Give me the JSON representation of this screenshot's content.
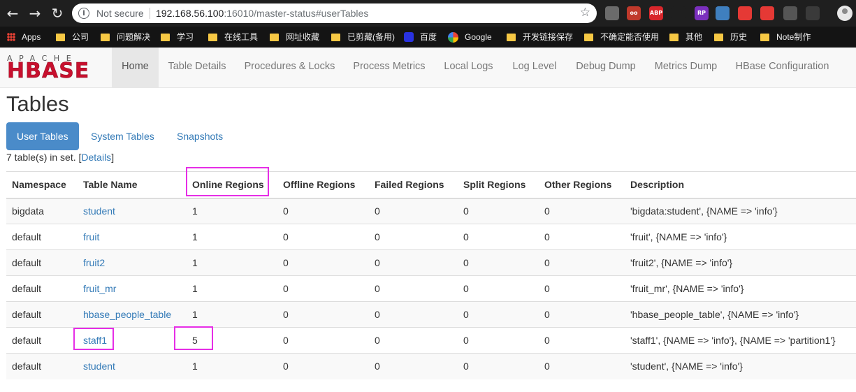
{
  "browser": {
    "security_label": "Not secure",
    "url_host": "192.168.56.100",
    "url_path": ":16010/master-status#userTables",
    "extensions": [
      {
        "name": "evernote-icon",
        "text": "",
        "color": "#6b6b6b"
      },
      {
        "name": "owl-icon",
        "text": "oo",
        "color": "#c0392b"
      },
      {
        "name": "adblock-icon",
        "text": "ABP",
        "color": "#d8262b"
      },
      {
        "name": "cursor-icon",
        "text": "",
        "color": "#1f1f1f"
      },
      {
        "name": "rp-icon",
        "text": "RP",
        "color": "#7b2fbe"
      },
      {
        "name": "circle-icon",
        "text": "",
        "color": "#3f7fbf"
      },
      {
        "name": "search-ext-icon",
        "text": "",
        "color": "#e53935"
      },
      {
        "name": "red-ext-icon",
        "text": "",
        "color": "#e53935"
      },
      {
        "name": "cloud-icon",
        "text": "",
        "color": "#555555"
      },
      {
        "name": "face-icon",
        "text": "",
        "color": "#3a3a3a"
      }
    ]
  },
  "bookmarks": [
    {
      "label": "Apps",
      "icon": "apps-icon"
    },
    {
      "label": "公司",
      "icon": "folder-icon"
    },
    {
      "label": "问题解决",
      "icon": "folder-icon"
    },
    {
      "label": "学习",
      "icon": "folder-icon"
    },
    {
      "label": "在线工具",
      "icon": "folder-icon"
    },
    {
      "label": "网址收藏",
      "icon": "folder-icon"
    },
    {
      "label": "已剪藏(备用)",
      "icon": "folder-icon"
    },
    {
      "label": "百度",
      "icon": "baidu-icon"
    },
    {
      "label": "Google",
      "icon": "google-icon"
    },
    {
      "label": "开发链接保存",
      "icon": "folder-icon"
    },
    {
      "label": "不确定能否使用",
      "icon": "folder-icon"
    },
    {
      "label": "其他",
      "icon": "folder-icon"
    },
    {
      "label": "历史",
      "icon": "folder-icon"
    },
    {
      "label": "Note制作",
      "icon": "folder-icon"
    }
  ],
  "logo": {
    "top": "APACHE",
    "main": "HBASE"
  },
  "nav": [
    {
      "label": "Home",
      "active": true
    },
    {
      "label": "Table Details"
    },
    {
      "label": "Procedures & Locks"
    },
    {
      "label": "Process Metrics"
    },
    {
      "label": "Local Logs"
    },
    {
      "label": "Log Level"
    },
    {
      "label": "Debug Dump"
    },
    {
      "label": "Metrics Dump"
    },
    {
      "label": "HBase Configuration"
    }
  ],
  "page": {
    "title": "Tables",
    "tabs": [
      {
        "label": "User Tables",
        "active": true
      },
      {
        "label": "System Tables"
      },
      {
        "label": "Snapshots"
      }
    ],
    "count_prefix": "7 table(s) in set. [",
    "count_link": "Details",
    "count_suffix": "]"
  },
  "table": {
    "headers": [
      "Namespace",
      "Table Name",
      "Online Regions",
      "Offline Regions",
      "Failed Regions",
      "Split Regions",
      "Other Regions",
      "Description"
    ],
    "rows": [
      [
        "bigdata",
        "student",
        "1",
        "0",
        "0",
        "0",
        "0",
        "'bigdata:student', {NAME => 'info'}"
      ],
      [
        "default",
        "fruit",
        "1",
        "0",
        "0",
        "0",
        "0",
        "'fruit', {NAME => 'info'}"
      ],
      [
        "default",
        "fruit2",
        "1",
        "0",
        "0",
        "0",
        "0",
        "'fruit2', {NAME => 'info'}"
      ],
      [
        "default",
        "fruit_mr",
        "1",
        "0",
        "0",
        "0",
        "0",
        "'fruit_mr', {NAME => 'info'}"
      ],
      [
        "default",
        "hbase_people_table",
        "1",
        "0",
        "0",
        "0",
        "0",
        "'hbase_people_table', {NAME => 'info'}"
      ],
      [
        "default",
        "staff1",
        "5",
        "0",
        "0",
        "0",
        "0",
        "'staff1', {NAME => 'info'}, {NAME => 'partition1'}"
      ],
      [
        "default",
        "student",
        "1",
        "0",
        "0",
        "0",
        "0",
        "'student', {NAME => 'info'}"
      ]
    ]
  },
  "colors": {
    "highlight": "#e62ee6",
    "link": "#337ab7",
    "active_tab": "#4a8bc9",
    "hbase_red": "#c8102e"
  }
}
